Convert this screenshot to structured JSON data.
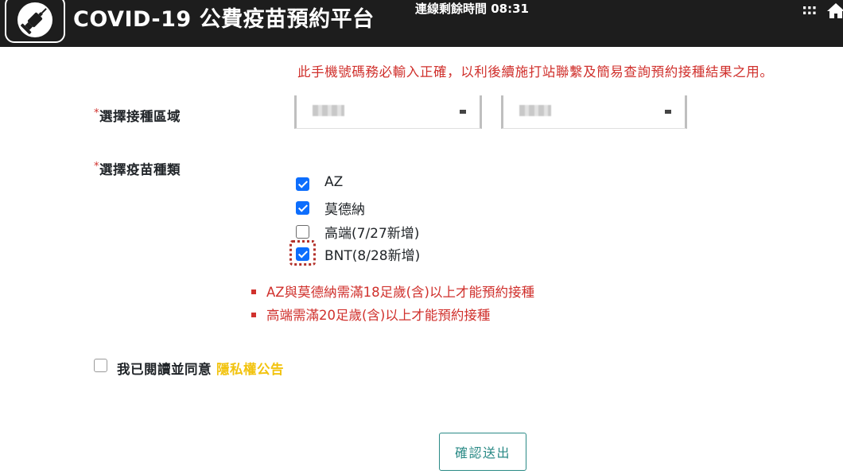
{
  "header": {
    "app_title": "COVID-19 公費疫苗預約平台",
    "session_timer": "連線剩餘時間 08:31",
    "menu_icon": "grid-dots-icon",
    "home_icon": "home-icon",
    "logo_icon": "syringe-icon",
    "background_color": "#1d1d1d"
  },
  "form": {
    "phone_notice": "此手機號碼務必輸入正確，以利後續施打站聯繫及簡易查詢預約接種結果之用。",
    "required_mark": "*",
    "region": {
      "label": "選擇接種區域",
      "selects": [
        {
          "value": ""
        },
        {
          "value": ""
        }
      ]
    },
    "vaccine": {
      "label": "選擇疫苗種類",
      "options": [
        {
          "label": "AZ",
          "checked": true
        },
        {
          "label": "莫德納",
          "checked": true
        },
        {
          "label": "高端(7/27新增)",
          "checked": false
        },
        {
          "label": "BNT(8/28新增)",
          "checked": true,
          "focused": true
        }
      ],
      "rules": [
        "AZ與莫德納需滿18足歲(含)以上才能預約接種",
        "高端需滿20足歲(含)以上才能預約接種"
      ]
    },
    "agreement": {
      "text": "我已閱讀並同意",
      "link": "隱私權公告",
      "checked": false
    },
    "submit_label": "確認送出"
  },
  "colors": {
    "notice_red": "#d0312d",
    "checkbox_blue": "#0d6efd",
    "link_yellow": "#f2c30f",
    "button_teal": "#2a8a86"
  }
}
